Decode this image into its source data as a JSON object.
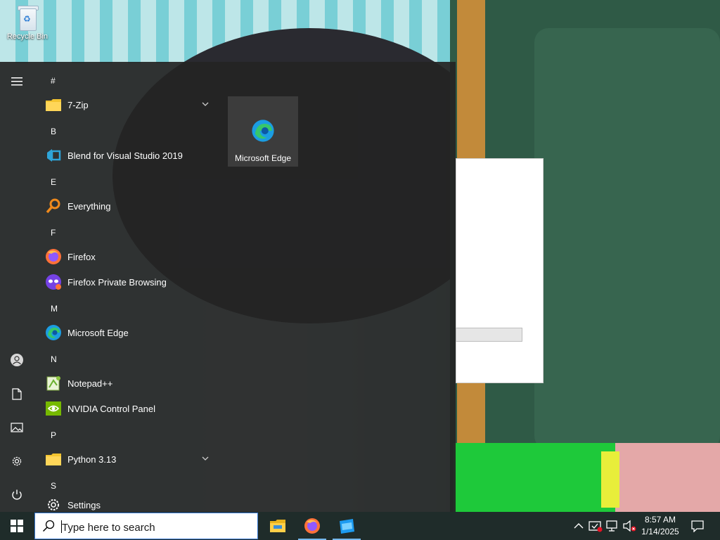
{
  "desktop": {
    "icons": [
      {
        "label": "Recycle Bin",
        "icon": "recycle-bin-icon"
      }
    ]
  },
  "start_menu": {
    "rail": {
      "menu_icon": "hamburger-icon",
      "bottom_icons": [
        "user-icon",
        "documents-icon",
        "pictures-icon",
        "settings-icon",
        "power-icon"
      ]
    },
    "sections": [
      {
        "letter": "#",
        "items": [
          {
            "label": "7-Zip",
            "icon": "folder-icon",
            "expandable": true
          }
        ]
      },
      {
        "letter": "B",
        "items": [
          {
            "label": "Blend for Visual Studio 2019",
            "icon": "blend-icon"
          }
        ]
      },
      {
        "letter": "E",
        "items": [
          {
            "label": "Everything",
            "icon": "magnifier-icon"
          }
        ]
      },
      {
        "letter": "F",
        "items": [
          {
            "label": "Firefox",
            "icon": "firefox-icon"
          },
          {
            "label": "Firefox Private Browsing",
            "icon": "firefox-private-icon"
          }
        ]
      },
      {
        "letter": "M",
        "items": [
          {
            "label": "Microsoft Edge",
            "icon": "edge-icon"
          }
        ]
      },
      {
        "letter": "N",
        "items": [
          {
            "label": "Notepad++",
            "icon": "notepadpp-icon"
          },
          {
            "label": "NVIDIA Control Panel",
            "icon": "nvidia-icon"
          }
        ]
      },
      {
        "letter": "P",
        "items": [
          {
            "label": "Python 3.13",
            "icon": "folder-icon",
            "expandable": true
          }
        ]
      },
      {
        "letter": "S",
        "items": [
          {
            "label": "Settings",
            "icon": "gear-icon"
          }
        ]
      }
    ],
    "pinned_tiles": [
      {
        "label": "Microsoft Edge",
        "icon": "edge-icon"
      }
    ]
  },
  "taskbar": {
    "search_placeholder": "Type here to search",
    "apps": [
      {
        "name": "File Explorer",
        "icon": "file-explorer-icon"
      },
      {
        "name": "Firefox",
        "icon": "firefox-icon"
      },
      {
        "name": "Roblox Studio",
        "icon": "roblox-studio-icon"
      }
    ],
    "tray_icons": [
      "chevron-up-icon",
      "security-alert-icon",
      "network-disconnected-icon",
      "volume-muted-icon"
    ],
    "clock": {
      "time": "8:57 AM",
      "date": "1/14/2025"
    },
    "notification_icon": "action-center-icon"
  },
  "colors": {
    "accent": "#0078d7",
    "menu_bg": "#242424",
    "taskbar_bg": "#1f2c2a"
  }
}
